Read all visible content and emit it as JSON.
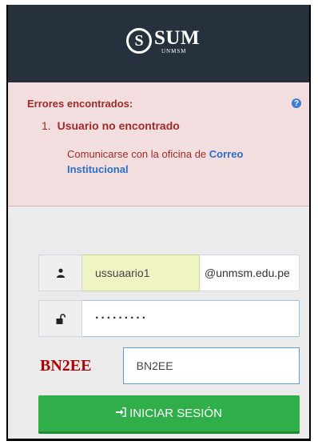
{
  "header": {
    "logo_letter": "S",
    "logo_text": "SUM",
    "logo_subtext": "UNMSM"
  },
  "error": {
    "title": "Errores encontrados:",
    "items": [
      {
        "number": "1.",
        "message": "Usuario no encontrado",
        "detail_prefix": "Comunicarse con la oficina de ",
        "detail_link": "Correo Institucional"
      }
    ],
    "help_icon": "question-circle-icon"
  },
  "form": {
    "username": {
      "icon": "user-icon",
      "value": "ussuaario1",
      "suffix": "@unmsm.edu.pe"
    },
    "password": {
      "icon": "unlock-icon",
      "value": "·········"
    },
    "captcha": {
      "image_text": "BN2EE",
      "value": "BN2EE"
    },
    "submit": {
      "icon": "sign-in-icon",
      "label": "INICIAR SESIÓN"
    }
  },
  "colors": {
    "header_bg": "#26313d",
    "error_bg": "#f2dede",
    "error_text": "#a02a2a",
    "link": "#2a6fc9",
    "button": "#2fae4a"
  }
}
